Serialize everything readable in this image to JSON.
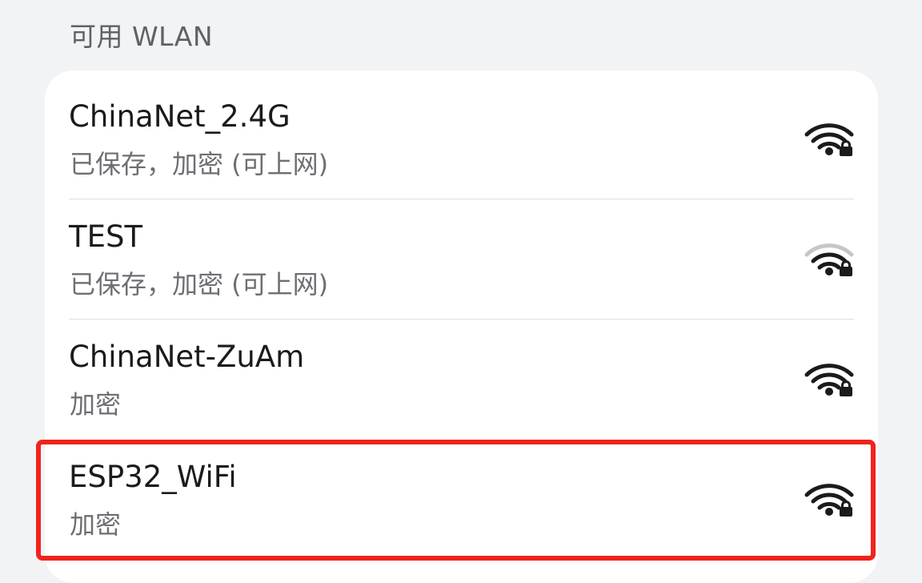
{
  "section_title": "可用 WLAN",
  "networks": [
    {
      "ssid": "ChinaNet_2.4G",
      "status": "已保存，加密 (可上网)",
      "icon": "wifi-lock-icon",
      "signal": "full"
    },
    {
      "ssid": "TEST",
      "status": "已保存，加密 (可上网)",
      "icon": "wifi-lock-icon",
      "signal": "three-quarters"
    },
    {
      "ssid": "ChinaNet-ZuAm",
      "status": "加密",
      "icon": "wifi-lock-icon",
      "signal": "full"
    },
    {
      "ssid": "ESP32_WiFi",
      "status": "加密",
      "icon": "wifi-lock-icon",
      "signal": "full"
    }
  ],
  "colors": {
    "highlight_border": "#f0231c",
    "signal_active": "#1b1b1d",
    "signal_inactive": "#c4c6c9"
  }
}
